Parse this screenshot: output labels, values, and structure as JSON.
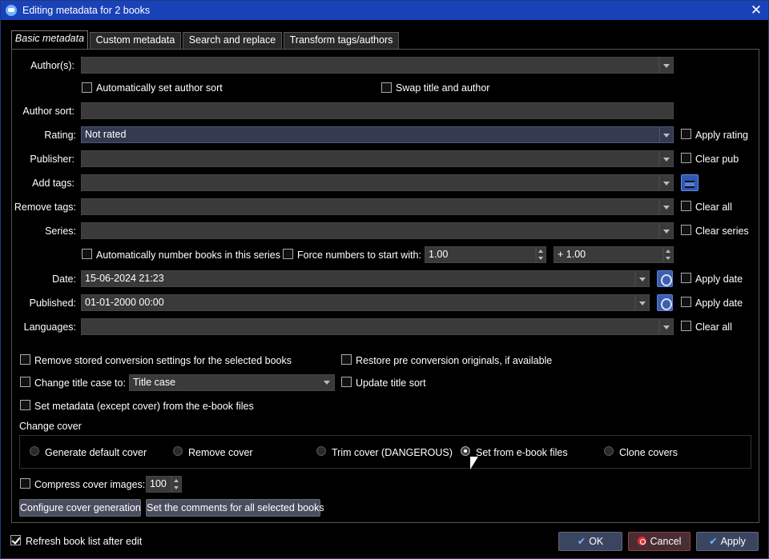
{
  "window": {
    "title": "Editing metadata for 2 books",
    "close": "✕"
  },
  "tabs": [
    {
      "label": "Basic metadata",
      "active": true
    },
    {
      "label": "Custom metadata",
      "active": false
    },
    {
      "label": "Search and replace",
      "active": false
    },
    {
      "label": "Transform tags/authors",
      "active": false
    }
  ],
  "fields": {
    "authors": {
      "label": "Author(s):",
      "value": ""
    },
    "auto_author_sort": "Automatically set author sort",
    "swap_title_author": "Swap title and author",
    "author_sort": {
      "label": "Author sort:",
      "value": ""
    },
    "rating": {
      "label": "Rating:",
      "value": "Not rated",
      "side": "Apply rating"
    },
    "publisher": {
      "label": "Publisher:",
      "value": "",
      "side": "Clear pub"
    },
    "add_tags": {
      "label": "Add tags:",
      "value": ""
    },
    "remove_tags": {
      "label": "Remove tags:",
      "value": "",
      "side": "Clear all"
    },
    "series": {
      "label": "Series:",
      "value": "",
      "side": "Clear series"
    },
    "auto_number": "Automatically number books in this series",
    "force_numbers": "Force numbers to start with:",
    "start_number": "1.00",
    "increment": "+ 1.00",
    "date": {
      "label": "Date:",
      "value": "15-06-2024 21:23",
      "side": "Apply date"
    },
    "published": {
      "label": "Published:",
      "value": "01-01-2000 00:00",
      "side": "Apply date"
    },
    "languages": {
      "label": "Languages:",
      "value": "",
      "side": "Clear all"
    }
  },
  "options": {
    "remove_conversion": "Remove stored conversion settings for the selected books",
    "restore_originals": "Restore pre conversion originals, if available",
    "change_title_case": "Change title case to:",
    "title_case_value": "Title case",
    "update_title_sort": "Update title sort",
    "set_metadata_files": "Set metadata (except cover) from the e-book files"
  },
  "cover": {
    "heading": "Change cover",
    "radios": [
      {
        "label": "Generate default cover",
        "checked": false
      },
      {
        "label": "Remove cover",
        "checked": false
      },
      {
        "label": "Trim cover (DANGEROUS)",
        "checked": false
      },
      {
        "label": "Set from e-book files",
        "checked": true
      },
      {
        "label": "Clone covers",
        "checked": false
      }
    ],
    "compress_label": "Compress cover images:",
    "compress_value": "100",
    "configure_btn": "Configure cover generation",
    "comments_btn": "Set the comments for all selected books"
  },
  "footer": {
    "refresh": "Refresh book list after edit",
    "refresh_checked": true,
    "ok": "OK",
    "cancel": "Cancel",
    "apply": "Apply"
  }
}
